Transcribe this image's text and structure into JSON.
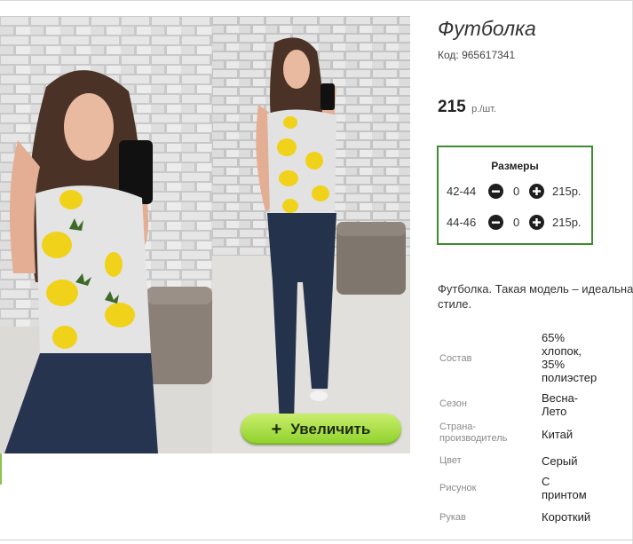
{
  "product": {
    "title": "Футболка",
    "code": "Код: 965617341",
    "price_value": "215",
    "price_unit": "р./шт.",
    "zoom_button": "Увеличить",
    "zoom_plus": "+",
    "description_line1": "Футболка. Такая модель – идеальна",
    "description_line2": "стиле."
  },
  "sizes": {
    "title": "Размеры",
    "items": [
      {
        "label": "42-44",
        "qty": "0",
        "price": "215р."
      },
      {
        "label": "44-46",
        "qty": "0",
        "price": "215р."
      }
    ]
  },
  "specs": [
    {
      "label": "Состав",
      "value": "65% хлопок, 35% полиэстер"
    },
    {
      "label": "Сезон",
      "value": "Весна-Лето"
    },
    {
      "label": "Страна-производитель",
      "value": "Китай"
    },
    {
      "label": "Цвет",
      "value": "Серый"
    },
    {
      "label": "Рисунок",
      "value": "С принтом"
    },
    {
      "label": "Рукав",
      "value": "Короткий"
    }
  ],
  "icons": {
    "minus": "minus-circle-icon",
    "plus": "plus-circle-icon"
  },
  "colors": {
    "sizes_border": "#3c8d2f",
    "zoom_button_top": "#c9ee6c",
    "zoom_button_bottom": "#8fd12c"
  }
}
